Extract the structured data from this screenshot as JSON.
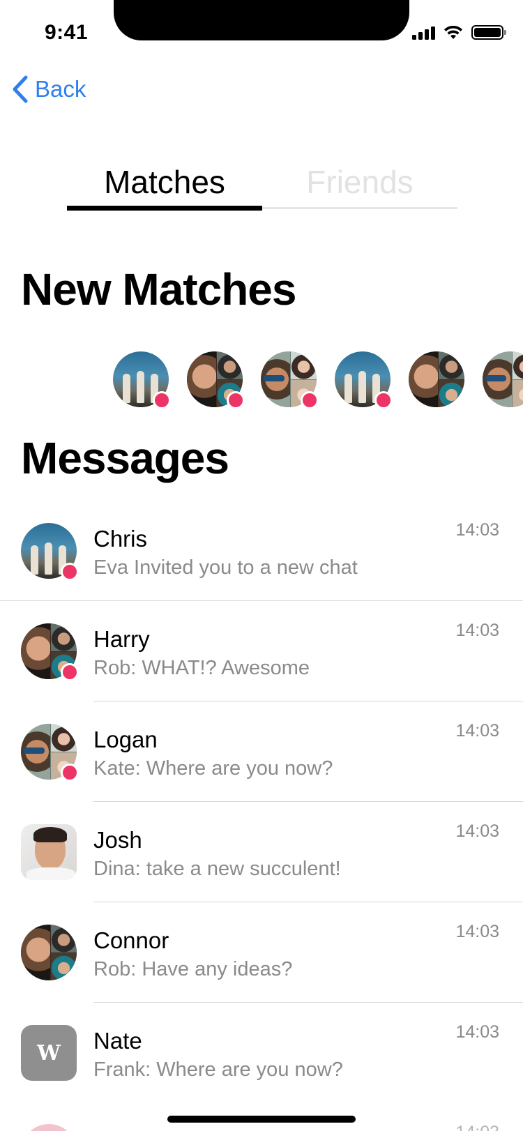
{
  "status_bar": {
    "time": "9:41"
  },
  "nav": {
    "back_label": "Back"
  },
  "tabs": [
    {
      "label": "Matches",
      "active": true
    },
    {
      "label": "Friends",
      "active": false
    }
  ],
  "sections": {
    "new_matches_title": "New Matches",
    "messages_title": "Messages"
  },
  "new_matches": [
    {
      "avatar": "troopers-photo",
      "unread": true
    },
    {
      "avatar": "collage-photo",
      "unread": true
    },
    {
      "avatar": "glasses-collage-photo",
      "unread": true
    },
    {
      "avatar": "troopers-photo",
      "unread": true
    },
    {
      "avatar": "collage-photo",
      "unread": false
    },
    {
      "avatar": "glasses-collage-photo",
      "unread": false
    }
  ],
  "messages": [
    {
      "name": "Chris",
      "preview": "Eva Invited you to a new chat",
      "time": "14:03",
      "avatar": "troopers-photo",
      "unread": true
    },
    {
      "name": "Harry",
      "preview": "Rob: WHAT!? Awesome",
      "time": "14:03",
      "avatar": "collage-photo",
      "unread": true
    },
    {
      "name": "Logan",
      "preview": "Kate: Where are you now?",
      "time": "14:03",
      "avatar": "glasses-collage-photo",
      "unread": true
    },
    {
      "name": "Josh",
      "preview": "Dina: take a new succulent!",
      "time": "14:03",
      "avatar": "man-portrait-photo",
      "unread": false
    },
    {
      "name": "Connor",
      "preview": "Rob: Have any ideas?",
      "time": "14:03",
      "avatar": "collage-photo",
      "unread": false
    },
    {
      "name": "Nate",
      "preview": "Frank: Where are you now?",
      "time": "14:03",
      "avatar": "w-letter-logo",
      "avatar_letter": "W",
      "unread": false
    }
  ],
  "colors": {
    "accent": "#2f7ff0",
    "unread_dot": "#ec3566",
    "secondary_text": "#8a8a8a"
  }
}
